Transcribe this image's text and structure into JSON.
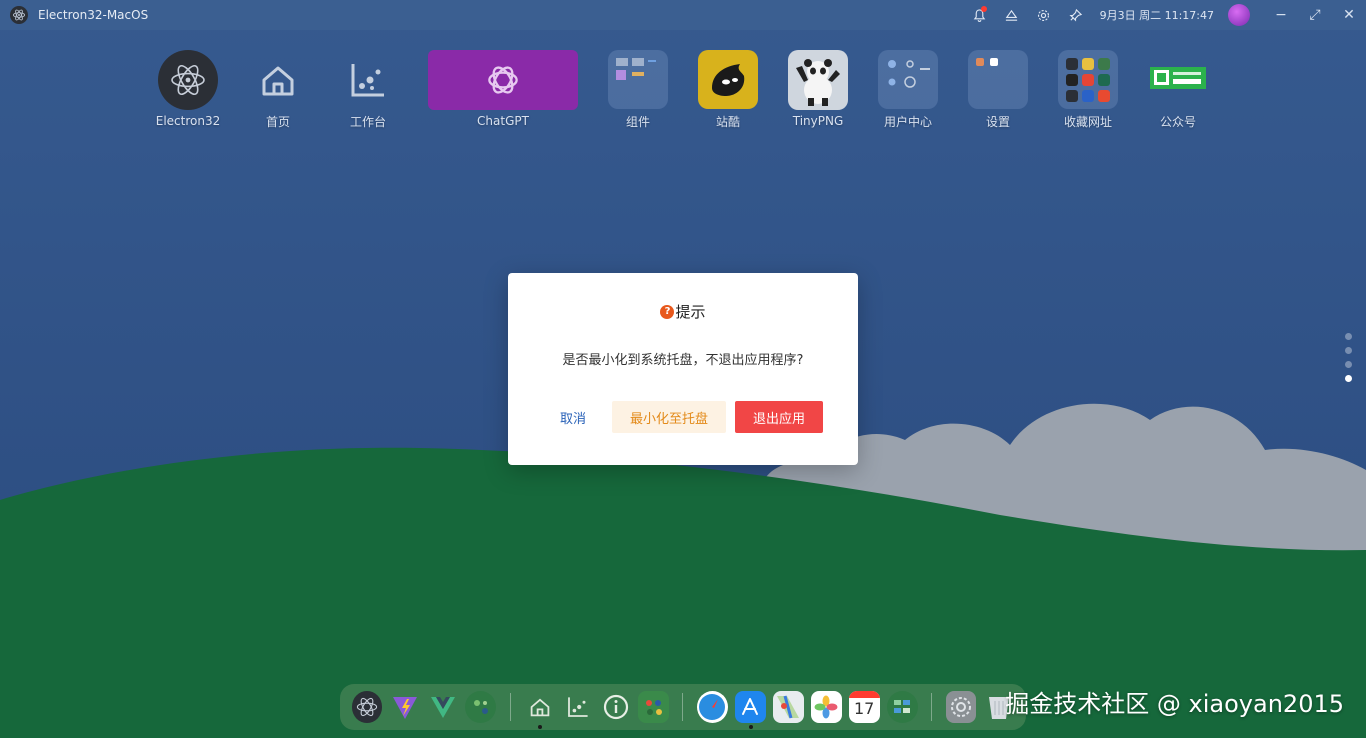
{
  "window": {
    "title": "Electron32-MacOS",
    "datetime": "9月3日 周二 11:17:47",
    "minimize": "−",
    "maximize": "⤢",
    "close": "✕"
  },
  "desktop_icons": [
    {
      "label": "Electron32",
      "icon": "electron-icon"
    },
    {
      "label": "首页",
      "icon": "home-icon"
    },
    {
      "label": "工作台",
      "icon": "chart-icon"
    },
    {
      "label": "ChatGPT",
      "icon": "openai-icon"
    },
    {
      "label": "组件",
      "icon": "widgets-icon"
    },
    {
      "label": "站酷",
      "icon": "zcool-icon"
    },
    {
      "label": "TinyPNG",
      "icon": "panda-icon"
    },
    {
      "label": "用户中心",
      "icon": "user-center-icon"
    },
    {
      "label": "设置",
      "icon": "settings-folder-icon"
    },
    {
      "label": "收藏网址",
      "icon": "bookmarks-folder-icon"
    },
    {
      "label": "公众号",
      "icon": "wechat-qrcode-icon"
    }
  ],
  "dialog": {
    "icon": "?",
    "title": "提示",
    "message": "是否最小化到系统托盘，不退出应用程序?",
    "cancel": "取消",
    "minimize": "最小化至托盘",
    "quit": "退出应用"
  },
  "dock": [
    "electron-icon",
    "vite-icon",
    "vue-icon",
    "photos-widget-icon",
    "home-icon",
    "chart-icon",
    "info-icon",
    "gallery-icon",
    "safari-icon",
    "appstore-icon",
    "maps-icon",
    "photos-icon",
    "calendar-icon",
    "widgets-icon",
    "settings-icon",
    "trash-icon"
  ],
  "calendar_day": "17",
  "watermark": "掘金技术社区 @ xiaoyan2015",
  "colors": {
    "accent_red": "#f14646",
    "accent_orange": "#e38a19",
    "link_blue": "#2962b8",
    "chatgpt_purple": "#8a2aa8"
  }
}
